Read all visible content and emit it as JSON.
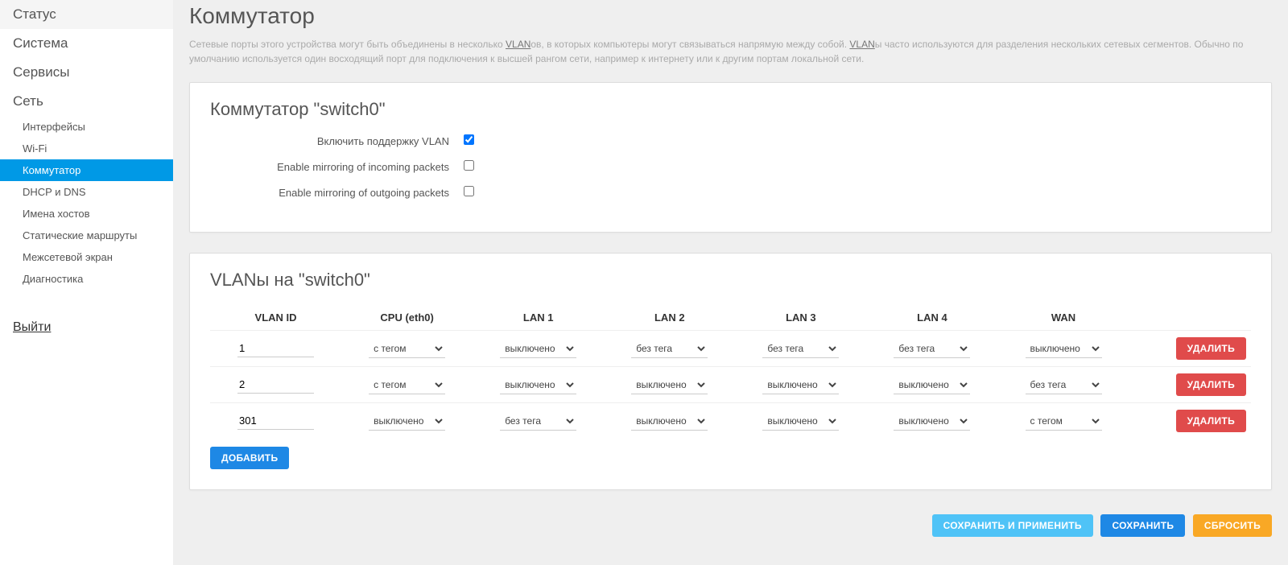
{
  "sidebar": {
    "top": [
      {
        "label": "Статус"
      },
      {
        "label": "Система"
      },
      {
        "label": "Сервисы"
      },
      {
        "label": "Сеть"
      }
    ],
    "sub": [
      {
        "label": "Интерфейсы",
        "active": false
      },
      {
        "label": "Wi-Fi",
        "active": false
      },
      {
        "label": "Коммутатор",
        "active": true
      },
      {
        "label": "DHCP и DNS",
        "active": false
      },
      {
        "label": "Имена хостов",
        "active": false
      },
      {
        "label": "Статические маршруты",
        "active": false
      },
      {
        "label": "Межсетевой экран",
        "active": false
      },
      {
        "label": "Диагностика",
        "active": false
      }
    ],
    "logout": "Выйти"
  },
  "page": {
    "title": "Коммутатор",
    "desc_pre": "Сетевые порты этого устройства могут быть объединены в несколько ",
    "vlan_word1": "VLAN",
    "desc_mid1": "ов, в которых компьютеры могут связываться напрямую между собой. ",
    "vlan_word2": "VLAN",
    "desc_post": "ы часто используются для разделения нескольких сетевых сегментов. Обычно по умолчанию используется один восходящий порт для подключения к высшей рангом сети, например к интернету или к другим портам локальной сети."
  },
  "switch_panel": {
    "title": "Коммутатор \"switch0\"",
    "rows": [
      {
        "label": "Включить поддержку VLAN",
        "checked": true
      },
      {
        "label": "Enable mirroring of incoming packets",
        "checked": false
      },
      {
        "label": "Enable mirroring of outgoing packets",
        "checked": false
      }
    ]
  },
  "vlan_panel": {
    "title": "VLANы на \"switch0\"",
    "headers": [
      "VLAN ID",
      "CPU (eth0)",
      "LAN 1",
      "LAN 2",
      "LAN 3",
      "LAN 4",
      "WAN",
      ""
    ],
    "options": [
      "выключено",
      "без тега",
      "с тегом"
    ],
    "rows": [
      {
        "id": "1",
        "ports": [
          "с тегом",
          "выключено",
          "без тега",
          "без тега",
          "без тега",
          "выключено"
        ]
      },
      {
        "id": "2",
        "ports": [
          "с тегом",
          "выключено",
          "выключено",
          "выключено",
          "выключено",
          "без тега"
        ]
      },
      {
        "id": "301",
        "ports": [
          "выключено",
          "без тега",
          "выключено",
          "выключено",
          "выключено",
          "с тегом"
        ]
      }
    ],
    "delete_label": "УДАЛИТЬ",
    "add_label": "ДОБАВИТЬ"
  },
  "footer": {
    "save_apply": "СОХРАНИТЬ И ПРИМЕНИТЬ",
    "save": "СОХРАНИТЬ",
    "reset": "СБРОСИТЬ"
  }
}
